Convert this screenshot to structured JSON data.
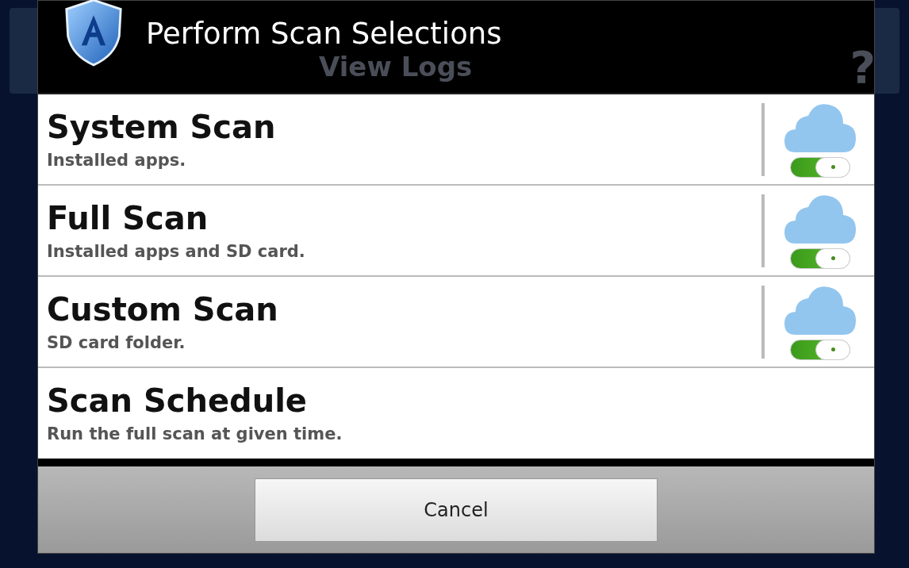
{
  "background_screen": {
    "title": "View Logs",
    "help": "?"
  },
  "dialog": {
    "title": "Perform Scan Selections"
  },
  "options": [
    {
      "title": "System Scan",
      "subtitle": "Installed apps.",
      "kind": "toggle",
      "cloud_on": true
    },
    {
      "title": "Full Scan",
      "subtitle": "Installed apps and SD card.",
      "kind": "toggle",
      "cloud_on": true
    },
    {
      "title": "Custom Scan",
      "subtitle": "SD card folder.",
      "kind": "toggle",
      "cloud_on": true
    },
    {
      "title": "Scan Schedule",
      "subtitle": "Run the full scan at given time.",
      "kind": "plain"
    }
  ],
  "buttons": [
    {
      "label": "Cancel"
    }
  ]
}
